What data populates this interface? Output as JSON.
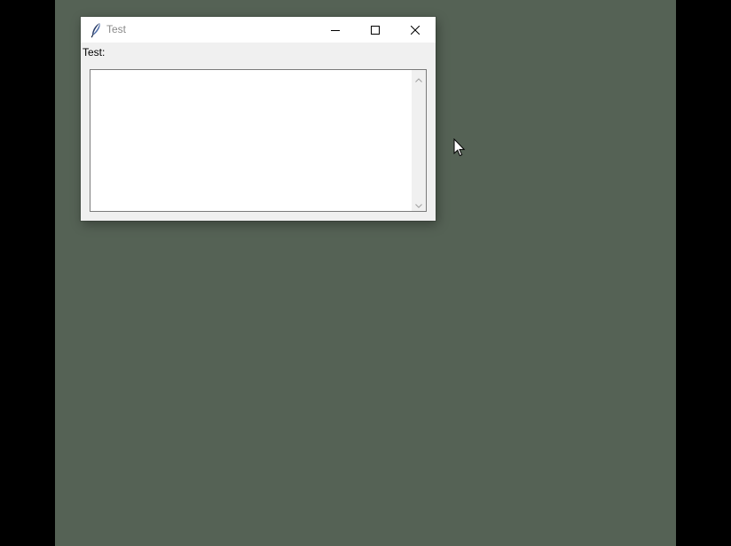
{
  "window": {
    "title": "Test",
    "app_icon": "feather-icon",
    "controls": {
      "minimize_icon": "minimize-icon",
      "maximize_icon": "maximize-icon",
      "close_icon": "close-icon"
    }
  },
  "form": {
    "label": "Test:",
    "text_value": ""
  },
  "colors": {
    "desktop": "#556255",
    "outer_background": "#000000",
    "window_body": "#f0f0f0",
    "titlebar": "#ffffff",
    "title_text": "#8a8a8a"
  }
}
